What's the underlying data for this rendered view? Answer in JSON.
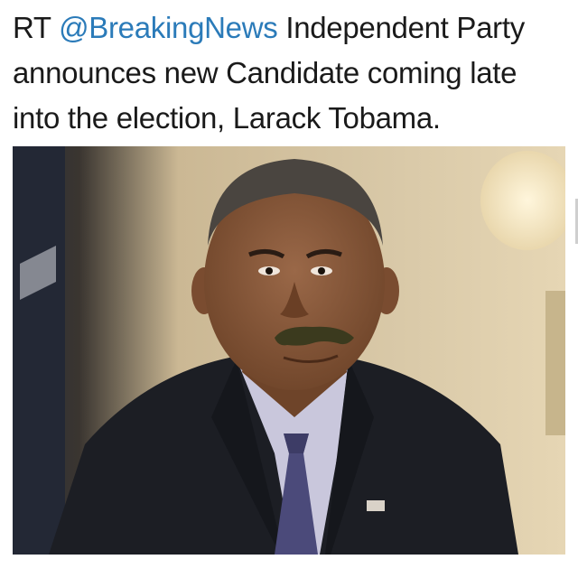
{
  "tweet": {
    "prefix": "RT",
    "mention": "@BreakingNews",
    "text_line1_rest": "Independent Party",
    "text_line2": "announces new Candidate coming late",
    "text_line3": "into the election, Larack Tobama."
  },
  "photo": {
    "subject": "man-in-suit-with-mustache",
    "colors": {
      "background_left": "#2a2f3a",
      "background_mid": "#d9c9a8",
      "lamp": "#f3e6c6",
      "suit": "#1c1e24",
      "shirt": "#c9c7dc",
      "tie": "#4b4a7a",
      "skin": "#8a5a3c",
      "hair": "#4a4540",
      "mustache": "#3b3a1e",
      "pin": "#d9d2c8"
    }
  }
}
